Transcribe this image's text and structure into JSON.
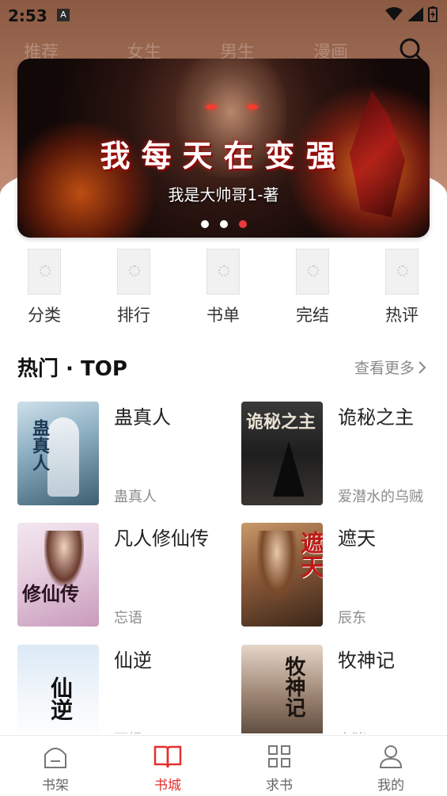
{
  "status_bar": {
    "time": "2:53",
    "notification_badge": "A"
  },
  "top_tabs": [
    "推荐",
    "女生",
    "男生",
    "漫画"
  ],
  "banner": {
    "title": "我每天在变强",
    "subtitle": "我是大帅哥1-著",
    "active_dot": 3,
    "dot_count": 3
  },
  "categories": [
    {
      "label": "分类"
    },
    {
      "label": "排行"
    },
    {
      "label": "书单"
    },
    {
      "label": "完结"
    },
    {
      "label": "热评"
    }
  ],
  "section": {
    "title": "热门 · TOP",
    "more_label": "查看更多"
  },
  "books": [
    {
      "title": "蛊真人",
      "author": "蛊真人",
      "cover_text": "蛊真人"
    },
    {
      "title": "诡秘之主",
      "author": "爱潜水的乌贼",
      "cover_text": "诡秘之主"
    },
    {
      "title": "凡人修仙传",
      "author": "忘语",
      "cover_text": "修仙传"
    },
    {
      "title": "遮天",
      "author": "辰东",
      "cover_text": "遮天"
    },
    {
      "title": "仙逆",
      "author": "耳根",
      "cover_text": "仙逆"
    },
    {
      "title": "牧神记",
      "author": "宅猪",
      "cover_text": "牧神记"
    }
  ],
  "bottom_nav": [
    {
      "label": "书架",
      "icon": "bookshelf-icon"
    },
    {
      "label": "书城",
      "icon": "open-book-icon",
      "active": true
    },
    {
      "label": "求书",
      "icon": "grid-icon"
    },
    {
      "label": "我的",
      "icon": "user-icon"
    }
  ],
  "colors": {
    "accent": "#e5302f",
    "muted_text": "#8c8c8c"
  }
}
